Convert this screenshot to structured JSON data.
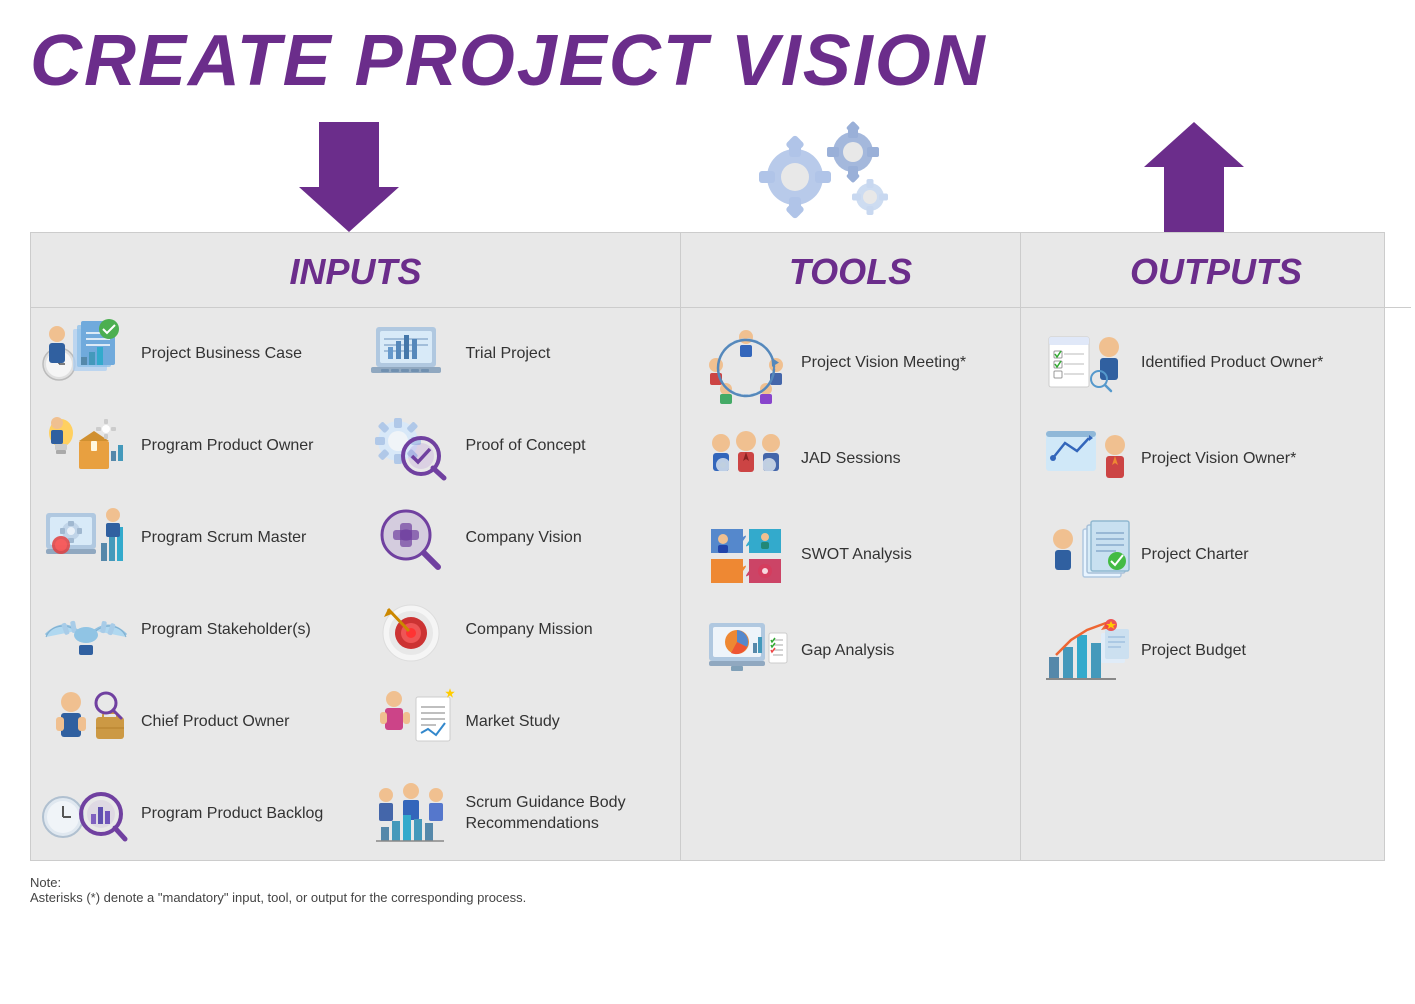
{
  "title": "CREATE PROJECT VISION",
  "sections": {
    "inputs": {
      "header": "INPUTS",
      "items": [
        {
          "label": "Project Business Case",
          "icon": "project-business-case"
        },
        {
          "label": "Trial Project",
          "icon": "trial-project"
        },
        {
          "label": "Program Product Owner",
          "icon": "program-product-owner"
        },
        {
          "label": "Proof of Concept",
          "icon": "proof-of-concept"
        },
        {
          "label": "Program Scrum Master",
          "icon": "program-scrum-master"
        },
        {
          "label": "Company Vision",
          "icon": "company-vision"
        },
        {
          "label": "Program Stakeholder(s)",
          "icon": "program-stakeholder"
        },
        {
          "label": "Company Mission",
          "icon": "company-mission"
        },
        {
          "label": "Chief Product Owner",
          "icon": "chief-product-owner"
        },
        {
          "label": "Market Study",
          "icon": "market-study"
        },
        {
          "label": "Program Product Backlog",
          "icon": "program-product-backlog"
        },
        {
          "label": "Scrum Guidance Body Recommendations",
          "icon": "scrum-guidance-body"
        }
      ]
    },
    "tools": {
      "header": "TOOLS",
      "items": [
        {
          "label": "Project Vision Meeting*",
          "icon": "project-vision-meeting"
        },
        {
          "label": "JAD Sessions",
          "icon": "jad-sessions"
        },
        {
          "label": "SWOT Analysis",
          "icon": "swot-analysis"
        },
        {
          "label": "Gap Analysis",
          "icon": "gap-analysis"
        }
      ]
    },
    "outputs": {
      "header": "OUTPUTS",
      "items": [
        {
          "label": "Identified Product Owner*",
          "icon": "identified-product-owner"
        },
        {
          "label": "Project Vision Owner*",
          "icon": "project-vision-owner"
        },
        {
          "label": "Project Charter",
          "icon": "project-charter"
        },
        {
          "label": "Project Budget",
          "icon": "project-budget"
        }
      ]
    }
  },
  "note": {
    "title": "Note:",
    "text": "Asterisks (*) denote a \"mandatory\" input, tool, or output for the corresponding process."
  }
}
